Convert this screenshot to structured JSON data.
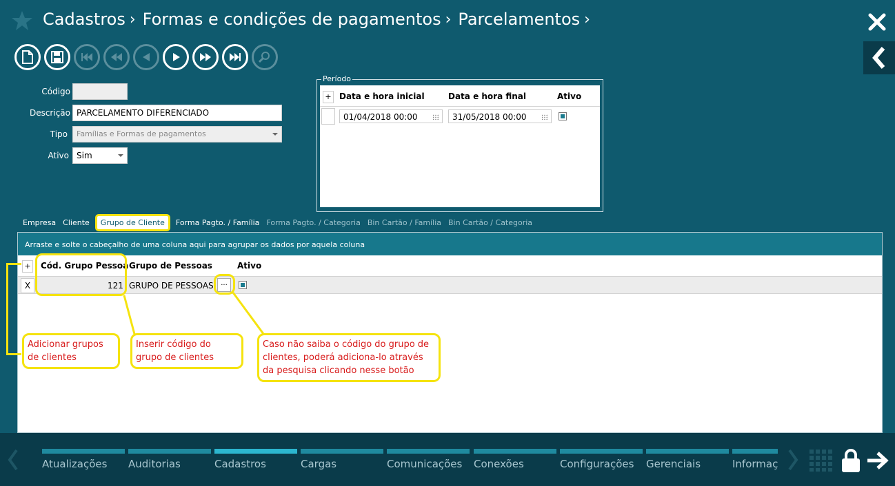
{
  "breadcrumb": [
    "Cadastros",
    "Formas e condições de pagamentos",
    "Parcelamentos"
  ],
  "form": {
    "codigo_label": "Código",
    "codigo_value": "",
    "descricao_label": "Descrição",
    "descricao_value": "PARCELAMENTO DIFERENCIADO",
    "tipo_label": "Tipo",
    "tipo_value": "Famílias e Formas de pagamentos",
    "ativo_label": "Ativo",
    "ativo_value": "Sim"
  },
  "periodo": {
    "legend": "Período",
    "add": "+",
    "col_inicial": "Data e hora inicial",
    "col_final": "Data e hora final",
    "col_ativo": "Ativo",
    "row_inicial": "01/04/2018 00:00",
    "row_final": "31/05/2018 00:00"
  },
  "tabs": [
    {
      "label": "Empresa"
    },
    {
      "label": "Cliente"
    },
    {
      "label": "Grupo de Cliente"
    },
    {
      "label": "Forma Pagto. / Família"
    },
    {
      "label": "Forma Pagto. / Categoria"
    },
    {
      "label": "Bin Cartão / Família"
    },
    {
      "label": "Bin Cartão / Categoria"
    }
  ],
  "grid": {
    "group_hint": "Arraste e solte o cabeçalho de uma coluna aqui para agrupar os dados por aquela coluna",
    "add": "+",
    "col_codigo": "Cód. Grupo Pessoa",
    "col_grupo": "Grupo de Pessoas",
    "col_ativo": "Ativo",
    "row_remove": "X",
    "row_codigo": "121",
    "row_grupo": "GRUPO DE PESSOAS",
    "row_search": "..."
  },
  "callouts": {
    "adicionar": "Adicionar grupos de clientes",
    "inserir": "Inserir código do grupo de clientes",
    "caso": "Caso não saiba o código do grupo de clientes, poderá adiciona-lo através da pesquisa clicando nesse botão"
  },
  "nav": [
    {
      "label": "Atualizações"
    },
    {
      "label": "Auditorias"
    },
    {
      "label": "Cadastros"
    },
    {
      "label": "Cargas"
    },
    {
      "label": "Comunicações"
    },
    {
      "label": "Conexões"
    },
    {
      "label": "Configurações"
    },
    {
      "label": "Gerenciais"
    },
    {
      "label": "Informaç"
    }
  ],
  "colors": {
    "background": "#0f5a6e",
    "accent": "#17788c",
    "highlight": "#f5e30f",
    "callout_text": "#d81b1b"
  }
}
